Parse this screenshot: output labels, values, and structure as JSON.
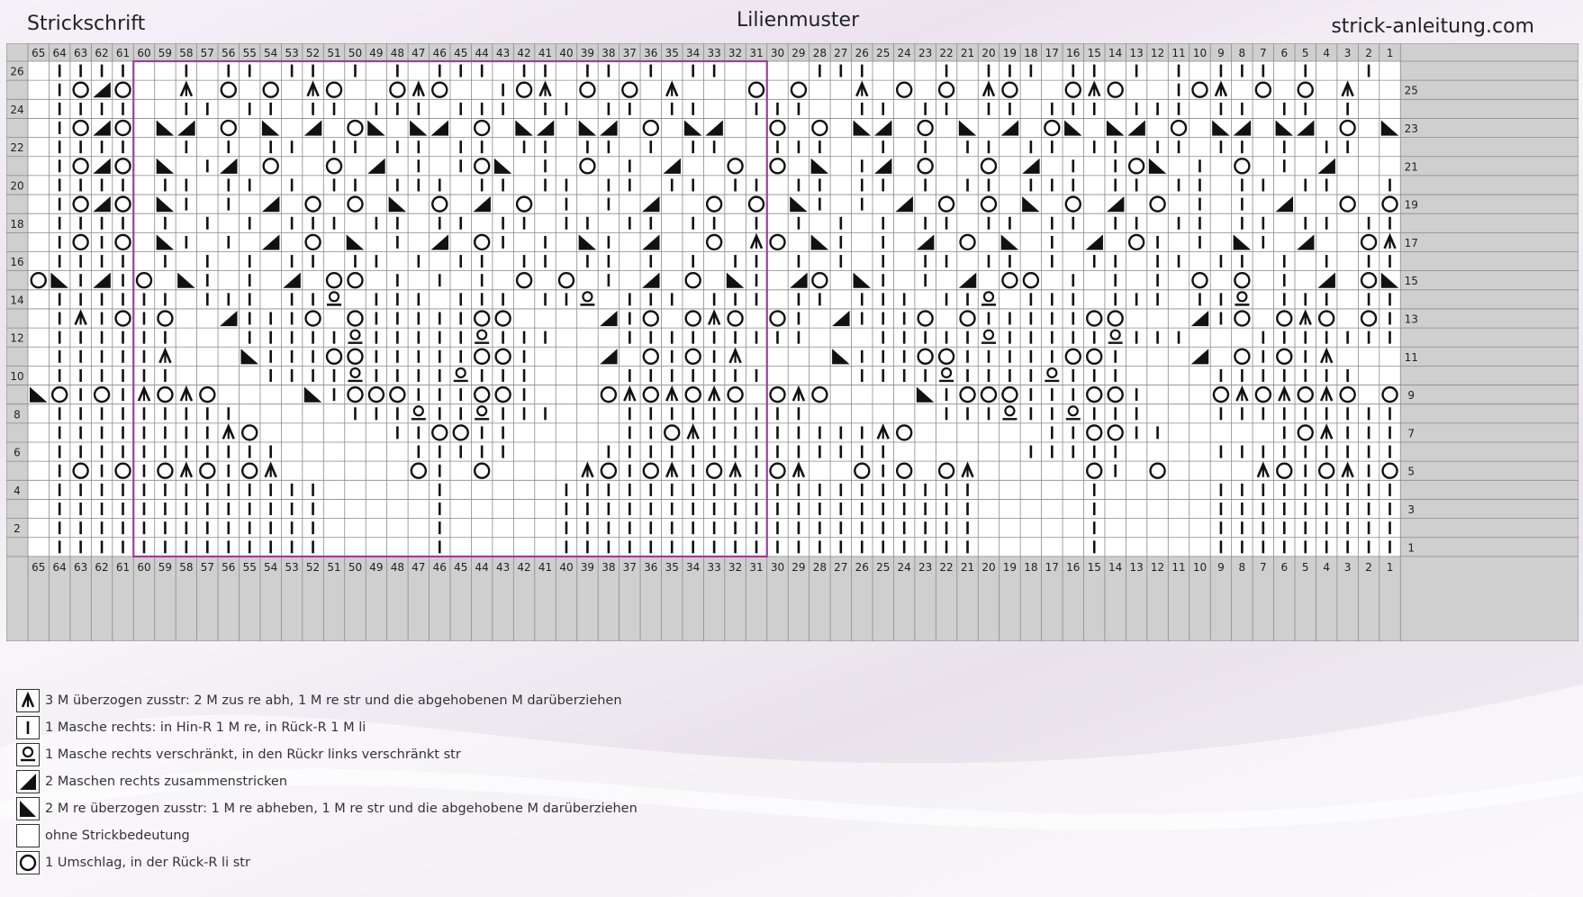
{
  "header": {
    "brand": "Strickschrift",
    "title": "Lilienmuster",
    "site": "strick-anleitung.com"
  },
  "colors": {
    "grid_line": "#8a8a8a",
    "header_fill": "#cfcfcf",
    "cell_fill": "#ffffff",
    "symbol": "#111111",
    "repeat_frame": "#9c3f9c"
  },
  "chart": {
    "columns": 65,
    "rows": 26,
    "column_numbers": [
      "65",
      "64",
      "63",
      "62",
      "61",
      "60",
      "59",
      "58",
      "57",
      "56",
      "55",
      "54",
      "53",
      "52",
      "51",
      "50",
      "49",
      "48",
      "47",
      "46",
      "45",
      "44",
      "43",
      "42",
      "41",
      "40",
      "39",
      "38",
      "37",
      "36",
      "35",
      "34",
      "33",
      "32",
      "31",
      "30",
      "29",
      "28",
      "27",
      "26",
      "25",
      "24",
      "23",
      "22",
      "21",
      "20",
      "19",
      "18",
      "17",
      "16",
      "15",
      "14",
      "13",
      "12",
      "11",
      "10",
      "9",
      "8",
      "7",
      "6",
      "5",
      "4",
      "3",
      "2",
      "1"
    ],
    "left_row_numbers": [
      "26",
      "24",
      "22",
      "20",
      "18",
      "16",
      "14",
      "12",
      "10",
      "8",
      "6",
      "4",
      "2"
    ],
    "right_row_numbers": [
      "25",
      "23",
      "21",
      "19",
      "17",
      "15",
      "13",
      "11",
      "9",
      "7",
      "5",
      "3",
      "1"
    ],
    "repeat_start_column": 60,
    "repeat_end_column": 31,
    "symbol_icons": {
      "k": "knit-stitch-icon",
      "o": "yarn-over-icon",
      "a": "double-decrease-icon",
      "r": "twisted-knit-icon",
      "t": "knit-two-together-icon",
      "s": "slip-knit-pass-icon",
      "x": "no-stitch-icon"
    },
    "rows_top_to_bottom": [
      ".kkkkxxkxkkxkkxkxkxkkkxkkxkkxkxkkxxxxkkkxxxkxkkkxkkxkxkxkkkxkxxkxx",
      ".koto.xaxoxoxaoxxoaoxxkoaxoxoxaxxxoxoxxaxoxoxaoxxoaoxxkoaxoxoxaxxso",
      ".kkkkxxkkxkkxkkxkkkxkkkxkkxkkxkkxxkkkxxkkxkkxkkxkkkxkkkxkkxkkxkxxkx",
      ".kotoxstxoxsxtxosxstxoxstxstxoxstxxoxoxstxoxsxtxosxstxoxstxstxoxstxso",
      ".kkkkxxkxkxkkxkkxkkxkkxkkxkkxkxkkxxkkkxxkxkxkkxkkxkkxkkxkkxkxkkxxkkkx",
      ".kotoxsxktxoxxoxtxkxkosxkxoxkxtxxoxoxsxktxoxxoxtxkxkosxkxoxkxtxxxsxo",
      ".kkkkxkkxkkxkxkkxkkkxkkxkkxkkxkkxkkxkkxkkxkxkkxkkkxkkxkkxkkxkkxxkkkx",
      ".kotoxskxkxtxoxoxsxoxtxoxkxkxtxxoxoxskxkxtxoxoxsxoxtxoxkxkxtxxoxoxso",
      ".kkkkxkxkxkxkkkxkkxkkxkkxkkxkkxkkxkxkxkxkxkkxkkxkkxkkxkkxkkxkkxkkxkx",
      ".kokoxskxkxtxoxsxkxtxokxkxskxtxxoxaoxskxkxtxoxsxkxtxokxkxskxtxxoaoxo",
      ".kkkkxkxkxkxkkxkkxkxkkxkkxkkxkxkxkkxkxkxkxkkxkkxkxkkxkkxkkxkxkxkkkx",
      "osktkoxskxkxtxooxkxkxkxoxoxkxtxoxskxtoxskxkxtxooxkxkxkxoxoxkxtxoskto",
      ".kkkkkkxkkkxkkrxkkkxkkkxkkrxkkkxkkkxkkxkkkxkkrxkkkxkkkxkkrxkkkxkkkxk",
      ".kakokoxxtkkkoxokkkkkooxxxxtkoxoaoxokxtkkkoxokkkkkooxxxtkoxoaoxokxxx",
      ".kkkkkkxxxkkkkkrkkkkkrkkkxxxkkkkkkkkkxxxkkkkkrkkkkkrkkkxxxkkkkkkkxxxx",
      ".kkkkkaxxxskkkookkkkkookxxxtxokokaxxxxskkkookkkkkookxxxtxokokaxxxxx",
      ".kkkkkkxxxxkkkkrkkkkrkkkxxxxkkkkkkkxxxxkkkkrkkkkrkkkxxxxkkkkkkkxxxxx",
      "sokokaoaoxxxxskoookkkookxxxoaoaoaoxoaoxxxxskoookkkookxxxoaoaoaoxokos",
      ".kkkkkkkkkxxxxxkkkrkkrkkkxxxkkkkkkkkkxxxxxxkkkrkkrkkkxxxkkkkkkkkkxkx",
      ".kkkkkkkkaoxxxxxxkkookkxxxxxkkoakkkkkkkkaoxxxxxxkkookkxxxxxkoakkkkxx",
      ".kkkkkkkkkkkxxxxxxkkkkkxxxxkkkkkkkkkkkkkkxxxxxxkkkkkxxxxkkkkkkkkkkkx",
      ".kokokoaokoaxxxxxxokxoxxxxaokoakoakoaxxokoxoaxxxxxokxoxxxxaokoakoaokx",
      ".kkkkkkkkkkkkkxxxxxkxxxxxkkkkkkkkkkkkkkkkkkkkxxxxxkxxxxxkkkkkkkkkkkkk",
      ".kkkkkkkkkkkkkxxxxxkxxxxxkkkkkkkkkkkkkkkkkkkkxxxxxkxxxxxkkkkkkkkkkkkk",
      ".kkkkkkkkkkkkkxxxxxkxxxxxkkkkkkkkkkkkkkkkkkkkxxxxxkxxxxxkkkkkkkkkkkkk",
      ".kkkkkkkkkkkkkxxxxxkxxxxxkkkkkkkkkkkkkkkkkkkkxxxxxkxxxxxkkkkkkkkkkkkk"
    ]
  },
  "legend": [
    {
      "icon": "double-decrease-icon",
      "key": "a",
      "text": "3 M überzogen zusstr: 2 M zus re abh, 1 M re str und die abgehobenen M darüberziehen"
    },
    {
      "icon": "knit-stitch-icon",
      "key": "k",
      "text": "1 Masche rechts: in Hin-R 1 M re, in Rück-R 1 M li"
    },
    {
      "icon": "twisted-knit-icon",
      "key": "r",
      "text": "1 Masche rechts verschränkt, in den Rückr links verschränkt str"
    },
    {
      "icon": "knit-two-together-icon",
      "key": "t",
      "text": "2 Maschen rechts zusammenstricken"
    },
    {
      "icon": "slip-knit-pass-icon",
      "key": "s",
      "text": "2 M re überzogen zusstr: 1 M re abheben, 1 M re str und die abgehobene M darüberziehen"
    },
    {
      "icon": "no-stitch-icon",
      "key": "x",
      "text": "ohne Strickbedeutung"
    },
    {
      "icon": "yarn-over-icon",
      "key": "o",
      "text": "1 Umschlag, in der Rück-R li str"
    }
  ]
}
